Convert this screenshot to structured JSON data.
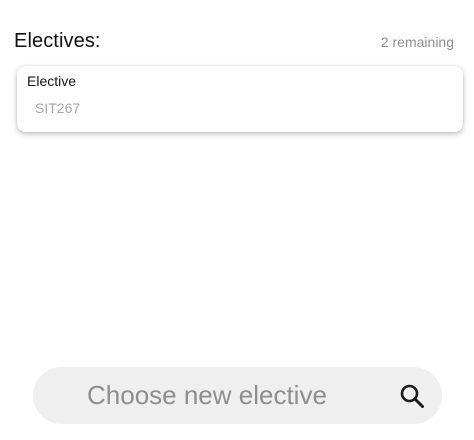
{
  "header": {
    "title": "Electives:",
    "remaining": "2 remaining"
  },
  "electives": [
    {
      "label": "Elective",
      "value": "SIT267"
    }
  ],
  "search": {
    "placeholder": "Choose new elective",
    "icon": "search-icon"
  },
  "colors": {
    "background": "#ffffff",
    "search_bg": "#efefef",
    "muted_text": "#8f8f8f"
  }
}
